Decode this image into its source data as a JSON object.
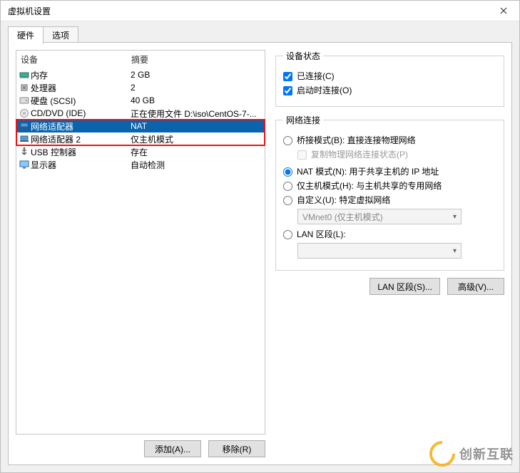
{
  "window": {
    "title": "虚拟机设置"
  },
  "tabs": {
    "hardware": "硬件",
    "options": "选项"
  },
  "devlist": {
    "header_device": "设备",
    "header_summary": "摘要",
    "items": [
      {
        "name": "内存",
        "summary": "2 GB",
        "icon": "mem"
      },
      {
        "name": "处理器",
        "summary": "2",
        "icon": "cpu"
      },
      {
        "name": "硬盘 (SCSI)",
        "summary": "40 GB",
        "icon": "hdd"
      },
      {
        "name": "CD/DVD (IDE)",
        "summary": "正在使用文件 D:\\iso\\CentOS-7-...",
        "icon": "cd"
      },
      {
        "name": "网络适配器",
        "summary": "NAT",
        "icon": "net",
        "selected": true
      },
      {
        "name": "网络适配器 2",
        "summary": "仅主机模式",
        "icon": "net"
      },
      {
        "name": "USB 控制器",
        "summary": "存在",
        "icon": "usb"
      },
      {
        "name": "显示器",
        "summary": "自动检测",
        "icon": "display"
      }
    ]
  },
  "left_buttons": {
    "add": "添加(A)...",
    "remove": "移除(R)"
  },
  "devstate": {
    "legend": "设备状态",
    "connected": "已连接(C)",
    "connect_at_poweron": "启动时连接(O)"
  },
  "netconn": {
    "legend": "网络连接",
    "bridged": "桥接模式(B): 直接连接物理网络",
    "replicate": "复制物理网络连接状态(P)",
    "nat": "NAT 模式(N): 用于共享主机的 IP 地址",
    "hostonly": "仅主机模式(H): 与主机共享的专用网络",
    "custom": "自定义(U): 特定虚拟网络",
    "custom_value": "VMnet0 (仅主机模式)",
    "lan": "LAN 区段(L):",
    "lan_value": ""
  },
  "right_buttons": {
    "lan": "LAN 区段(S)...",
    "advanced": "高级(V)..."
  },
  "watermark": "创新互联"
}
